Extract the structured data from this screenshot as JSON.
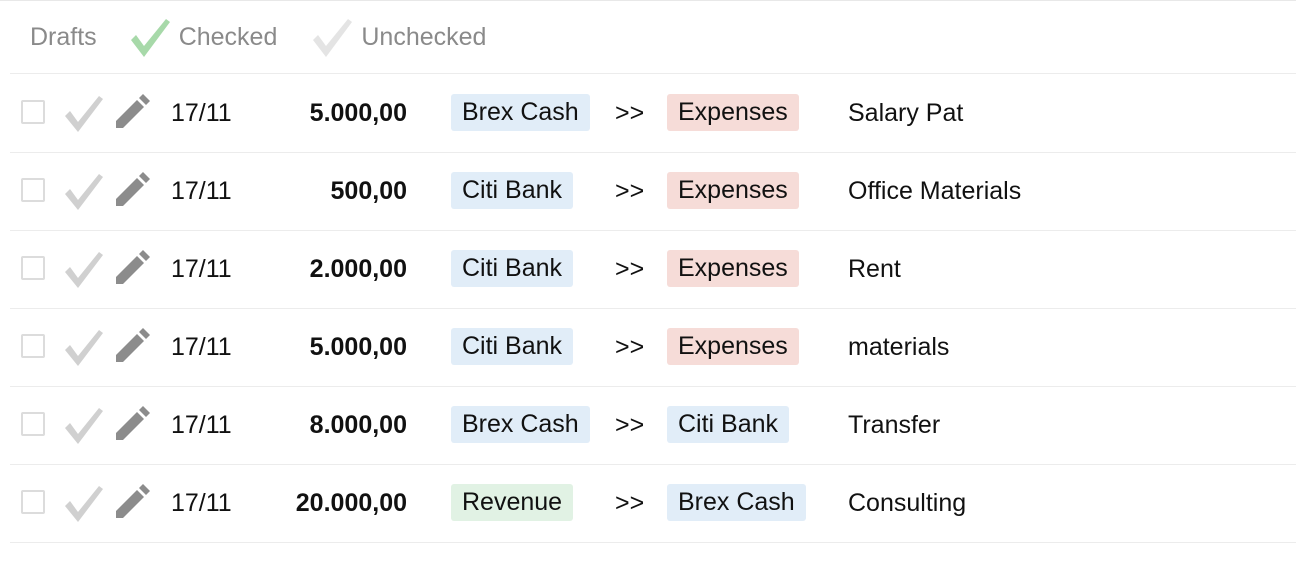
{
  "filters": {
    "drafts": "Drafts",
    "checked": "Checked",
    "unchecked": "Unchecked"
  },
  "icons": {
    "checked_filter": "green-check-icon",
    "unchecked_filter": "gray-check-icon",
    "row_check": "check-icon",
    "row_edit": "pencil-icon"
  },
  "colors": {
    "bank_tag": "#e1edf8",
    "expense_tag": "#f6dcd8",
    "revenue_tag": "#e1f2e4",
    "checked_green": "#a7d9a9",
    "muted_gray": "#d0d0d0",
    "pencil_gray": "#8c8c8c"
  },
  "separator": ">>",
  "transactions": [
    {
      "date": "17/11",
      "amount": "5.000,00",
      "from": "Brex Cash",
      "from_type": "bank",
      "to": "Expenses",
      "to_type": "expense",
      "description": "Salary Pat"
    },
    {
      "date": "17/11",
      "amount": "500,00",
      "from": "Citi Bank",
      "from_type": "bank",
      "to": "Expenses",
      "to_type": "expense",
      "description": "Office Materials"
    },
    {
      "date": "17/11",
      "amount": "2.000,00",
      "from": "Citi Bank",
      "from_type": "bank",
      "to": "Expenses",
      "to_type": "expense",
      "description": "Rent"
    },
    {
      "date": "17/11",
      "amount": "5.000,00",
      "from": "Citi Bank",
      "from_type": "bank",
      "to": "Expenses",
      "to_type": "expense",
      "description": "materials"
    },
    {
      "date": "17/11",
      "amount": "8.000,00",
      "from": "Brex Cash",
      "from_type": "bank",
      "to": "Citi Bank",
      "to_type": "bank",
      "description": "Transfer"
    },
    {
      "date": "17/11",
      "amount": "20.000,00",
      "from": "Revenue",
      "from_type": "revenue",
      "to": "Brex Cash",
      "to_type": "bank",
      "description": "Consulting"
    }
  ]
}
